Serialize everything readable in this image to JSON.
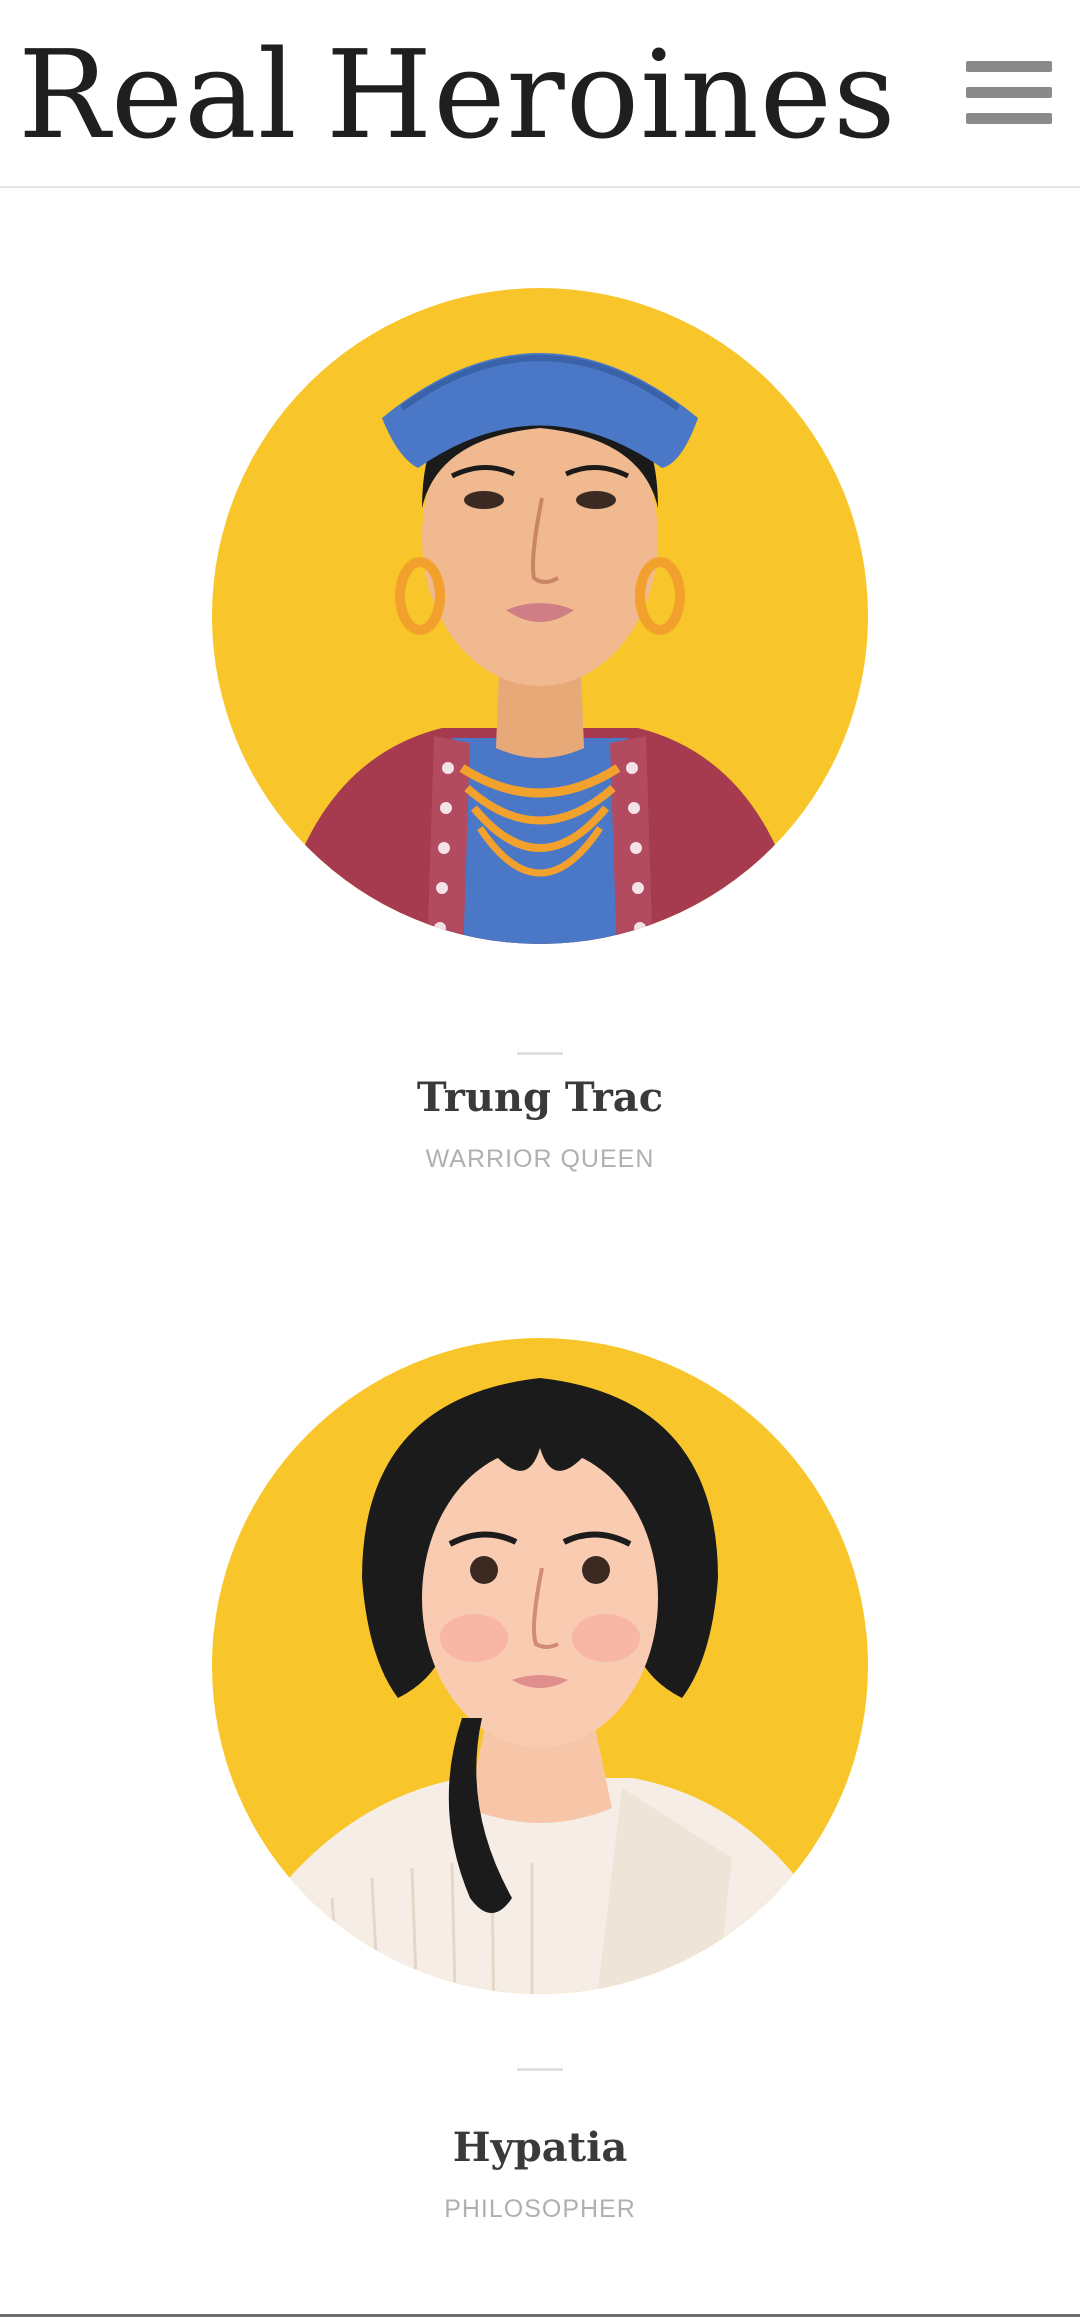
{
  "header": {
    "brand_word_1": "Real",
    "brand_word_2": "Heroines",
    "menu_icon": "hamburger-menu-icon"
  },
  "colors": {
    "portrait_background": "#F8C62A",
    "name_text": "#3A3A3A",
    "role_text": "#B0B0B0",
    "menu_icon": "#8A8A8A"
  },
  "heroines": [
    {
      "name": "Trung Trac",
      "role": "WARRIOR QUEEN",
      "portrait": "trung-trac-portrait"
    },
    {
      "name": "Hypatia",
      "role": "PHILOSOPHER",
      "portrait": "hypatia-portrait"
    }
  ]
}
